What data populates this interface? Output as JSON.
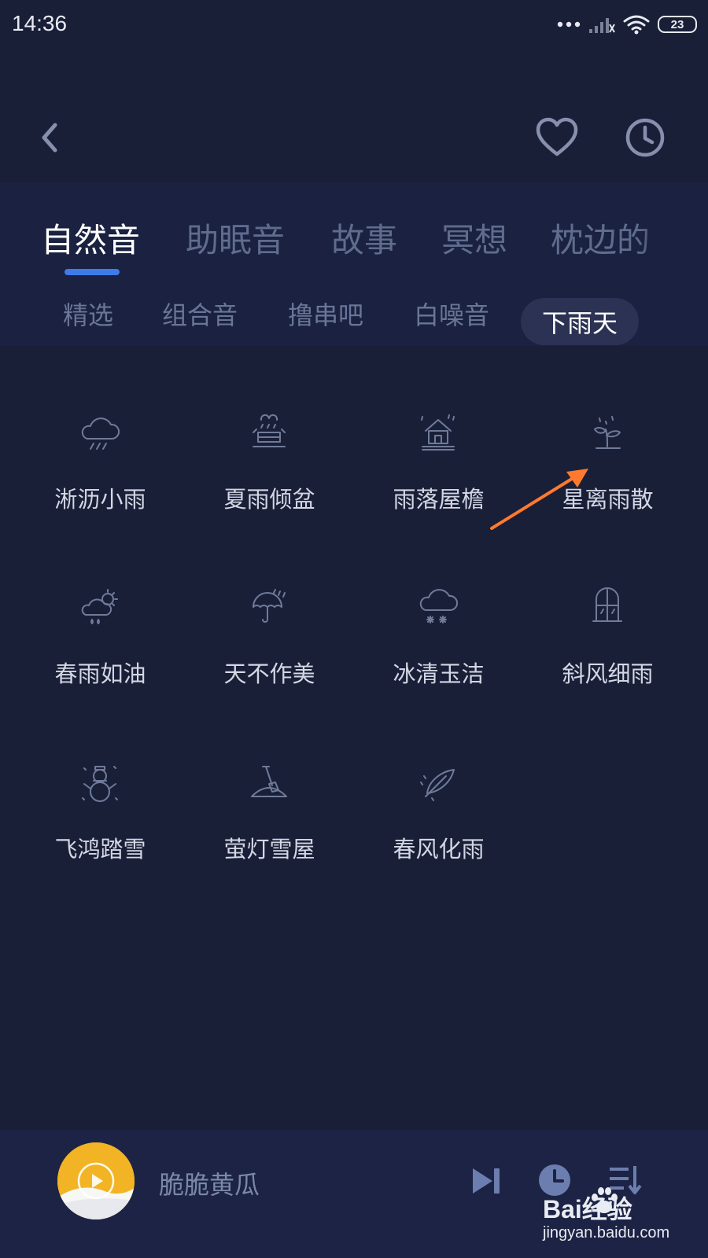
{
  "status_bar": {
    "time": "14:36",
    "battery": "23",
    "icons": [
      "more-dots-icon",
      "signal-icon",
      "wifi-icon",
      "battery-icon"
    ]
  },
  "header": {
    "icons": [
      "back-icon",
      "heart-icon",
      "clock-icon"
    ]
  },
  "category_tabs": [
    "自然音",
    "助眠音",
    "故事",
    "冥想",
    "枕边的"
  ],
  "sub_tabs": [
    "精选",
    "组合音",
    "撸串吧",
    "白噪音",
    "下雨天"
  ],
  "sounds": [
    {
      "label": "淅沥小雨",
      "icon": "rain-cloud-icon"
    },
    {
      "label": "夏雨倾盆",
      "icon": "downpour-icon"
    },
    {
      "label": "雨落屋檐",
      "icon": "house-rain-icon"
    },
    {
      "label": "星离雨散",
      "icon": "sprout-icon"
    },
    {
      "label": "春雨如油",
      "icon": "sun-cloud-rain-icon"
    },
    {
      "label": "天不作美",
      "icon": "umbrella-icon"
    },
    {
      "label": "冰清玉洁",
      "icon": "snow-cloud-icon"
    },
    {
      "label": "斜风细雨",
      "icon": "window-icon"
    },
    {
      "label": "飞鸿踏雪",
      "icon": "snowman-icon"
    },
    {
      "label": "萤灯雪屋",
      "icon": "shovel-icon"
    },
    {
      "label": "春风化雨",
      "icon": "feather-icon"
    }
  ],
  "player": {
    "track": "脆脆黄瓜",
    "icons": [
      "play-icon",
      "skip-next-icon",
      "timer-icon",
      "playlist-icon"
    ]
  },
  "watermark": {
    "text": "Bai经验",
    "url": "jingyan.baidu.com"
  },
  "colors": {
    "background": "#1a1f38",
    "accent": "#3e7be8",
    "annotation": "#ff7a2f"
  }
}
